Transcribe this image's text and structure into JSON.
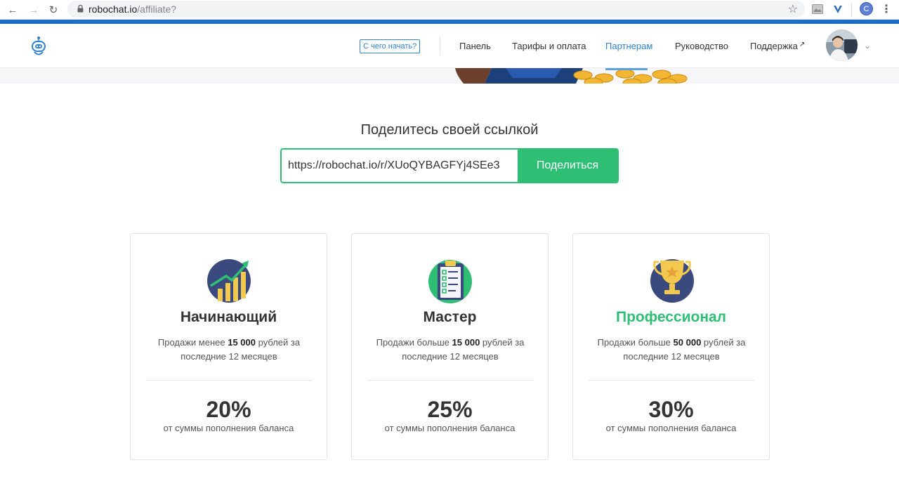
{
  "browser": {
    "url_host": "robochat.io",
    "url_path": "/affiliate?",
    "profile_initial": "C"
  },
  "header": {
    "start_button": "С чего начать?",
    "nav": [
      {
        "label": "Панель"
      },
      {
        "label": "Тарифы и оплата"
      },
      {
        "label": "Партнерам",
        "active": true
      },
      {
        "label": "Руководство"
      },
      {
        "label": "Поддержка",
        "external": true
      }
    ],
    "external_arrow": "↗"
  },
  "share": {
    "title": "Поделитесь своей ссылкой",
    "link": "https://robochat.io/r/XUoQYBAGFYj4SEe3",
    "button": "Поделиться"
  },
  "cards": [
    {
      "title": "Начинающий",
      "desc_prefix": "Продажи менее ",
      "amount": "15 000",
      "desc_suffix": " рублей за последние 12 месяцев",
      "percent": "20%",
      "sub": "от суммы пополнения баланса",
      "icon": "growth-chart-icon",
      "highlight": false
    },
    {
      "title": "Мастер",
      "desc_prefix": "Продажи больше ",
      "amount": "15 000",
      "desc_suffix": " рублей за последние 12 месяцев",
      "percent": "25%",
      "sub": "от суммы пополнения баланса",
      "icon": "clipboard-checklist-icon",
      "highlight": false
    },
    {
      "title": "Профессионал",
      "desc_prefix": "Продажи больше ",
      "amount": "50 000",
      "desc_suffix": " рублей за последние 12 месяцев",
      "percent": "30%",
      "sub": "от суммы пополнения баланса",
      "icon": "trophy-icon",
      "highlight": true
    }
  ],
  "colors": {
    "brand_blue": "#2f82d0",
    "accent_green": "#2ebf74",
    "icon_navy": "#3a4a7e",
    "icon_gold": "#f2c94c"
  }
}
